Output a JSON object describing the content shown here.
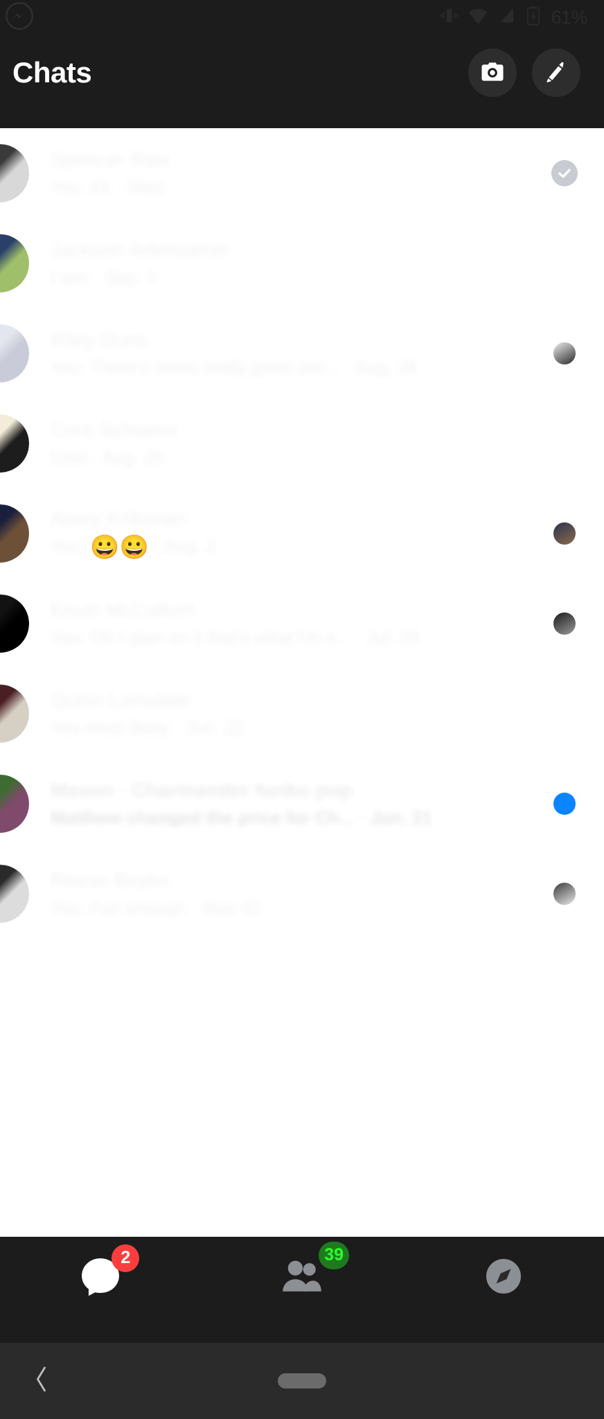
{
  "status_bar": {
    "app_icon": "messenger-icon",
    "vibrate_icon": "vibrate-icon",
    "wifi_icon": "wifi-icon",
    "signal_icon": "cellular-signal-icon",
    "battery_icon": "battery-charging-icon",
    "battery_text": "61%"
  },
  "header": {
    "title": "Chats",
    "camera_icon": "camera-icon",
    "compose_icon": "pencil-compose-icon"
  },
  "chats": [
    {
      "name": "Spencer Raw",
      "snippet": "You: Kk",
      "separator": " · ",
      "time": "Wed",
      "unread": false,
      "status": "seen-check",
      "avatar_a": "#3a3a3a",
      "avatar_b": "#d8d8d8"
    },
    {
      "name": "Jackson Adensamer",
      "snippet": "I sen",
      "separator": " · ",
      "time": "Sep. 1",
      "unread": false,
      "status": "none",
      "avatar_a": "#2b3f6b",
      "avatar_b": "#9fbf6a"
    },
    {
      "name": "Riley Duns",
      "snippet": "You: There's some really good son...",
      "separator": " · ",
      "time": "Aug. 26",
      "unread": false,
      "status": "seen-avatar",
      "avatar_a": "#e4e6ef",
      "avatar_b": "#c9ccd8",
      "status_avatar_a": "#efefef",
      "status_avatar_b": "#2a2a2a"
    },
    {
      "name": "Cora Schoenn",
      "snippet": "Cool",
      "separator": " · ",
      "time": "Aug. 25",
      "unread": false,
      "status": "none",
      "avatar_a": "#f2ecd8",
      "avatar_b": "#1d1d1d"
    },
    {
      "name": "Araxy Krikorian",
      "snippet_prefix": "You: ",
      "emoji": "😀😀",
      "separator": " · ",
      "time": "Aug. 2",
      "unread": false,
      "status": "seen-avatar",
      "avatar_a": "#1a1f3d",
      "avatar_b": "#6d5038",
      "status_avatar_a": "#2c3350",
      "status_avatar_b": "#8a6a4a"
    },
    {
      "name": "Kevin McCallum",
      "snippet": "You: Oh I plan on it that's what I'm s...",
      "separator": " · ",
      "time": "Jul. 29",
      "unread": false,
      "status": "seen-avatar",
      "avatar_a": "#121212",
      "avatar_b": "#000000",
      "status_avatar_a": "#1a1a1a",
      "status_avatar_b": "#9a9a9a"
    },
    {
      "name": "Quinn Lonsdale",
      "snippet": "Yea most likely",
      "separator": " · ",
      "time": "Jun. 22",
      "unread": false,
      "status": "none",
      "avatar_a": "#4a1f23",
      "avatar_b": "#d6cfc4"
    },
    {
      "name": "Mason · Charmander funko pop",
      "snippet": "Matthew changed the price for Ch...",
      "separator": " · ",
      "time": "Jun. 21",
      "unread": true,
      "status": "unread-dot",
      "avatar_a": "#3e6b32",
      "avatar_b": "#7f4a6b"
    },
    {
      "name": "Reese Boyko",
      "snippet": "You: Fair enough",
      "separator": " · ",
      "time": "May 31",
      "unread": false,
      "status": "seen-avatar",
      "avatar_a": "#2a2a2a",
      "avatar_b": "#dcdcdc",
      "status_avatar_a": "#3a3a3a",
      "status_avatar_b": "#e8e8e8"
    }
  ],
  "tabbar": {
    "items": [
      {
        "name": "chats-tab",
        "icon": "speech-bubble-icon",
        "badge": "2",
        "badge_color": "#fa3e3e",
        "active": true
      },
      {
        "name": "people-tab",
        "icon": "people-icon",
        "badge": "39",
        "badge_color": "#1f7a1f",
        "active": false
      },
      {
        "name": "discover-tab",
        "icon": "compass-icon",
        "badge": "",
        "badge_color": "",
        "active": false
      }
    ]
  },
  "android_nav": {
    "back_icon": "back-chevron-icon",
    "home_icon": "home-pill-icon"
  },
  "colors": {
    "accent_blue": "#0a84ff",
    "badge_red": "#fa3e3e",
    "badge_green": "#2bff2b",
    "header_bg": "#1c1c1c",
    "list_bg": "#ffffff"
  }
}
